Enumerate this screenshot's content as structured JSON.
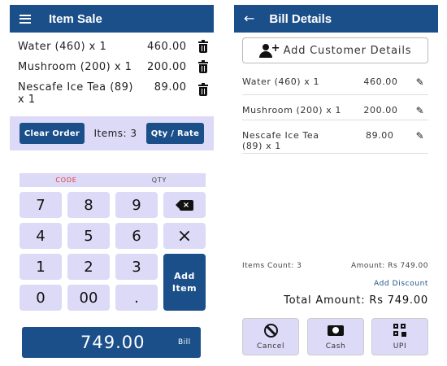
{
  "item_sale": {
    "title": "Item Sale",
    "items": [
      {
        "name": "Water (460) x 1",
        "price": "460.00"
      },
      {
        "name": "Mushroom (200) x 1",
        "price": "200.00"
      },
      {
        "name": "Nescafe Ice Tea (89) x 1",
        "price": "89.00"
      }
    ],
    "clear_order_label": "Clear Order",
    "items_label": "Items: 3",
    "qty_rate_label": "Qty / Rate",
    "code_label": "CODE",
    "qty_label": "QTY",
    "keys": {
      "k7": "7",
      "k8": "8",
      "k9": "9",
      "k4": "4",
      "k5": "5",
      "k6": "6",
      "k1": "1",
      "k2": "2",
      "k3": "3",
      "k0": "0",
      "k00": "00",
      "kdot": ".",
      "clear": "×",
      "add_item": "Add Item"
    },
    "total": "749.00",
    "bill_label": "Bill"
  },
  "bill_details": {
    "title": "Bill Details",
    "add_customer_label": "Add Customer Details",
    "items": [
      {
        "name": "Water (460) x 1",
        "price": "460.00"
      },
      {
        "name": "Mushroom (200) x 1",
        "price": "200.00"
      },
      {
        "name": "Nescafe Ice Tea (89) x 1",
        "price": "89.00"
      }
    ],
    "items_count": "Items Count: 3",
    "amount": "Amount: Rs 749.00",
    "add_discount": "Add Discount",
    "total_amount": "Total Amount: Rs 749.00",
    "payments": {
      "cancel": "Cancel",
      "cash": "Cash",
      "upi": "UPI"
    }
  },
  "colors": {
    "primary": "#1b4f8a",
    "light": "#dcdaf7",
    "code_red": "#e53935"
  }
}
